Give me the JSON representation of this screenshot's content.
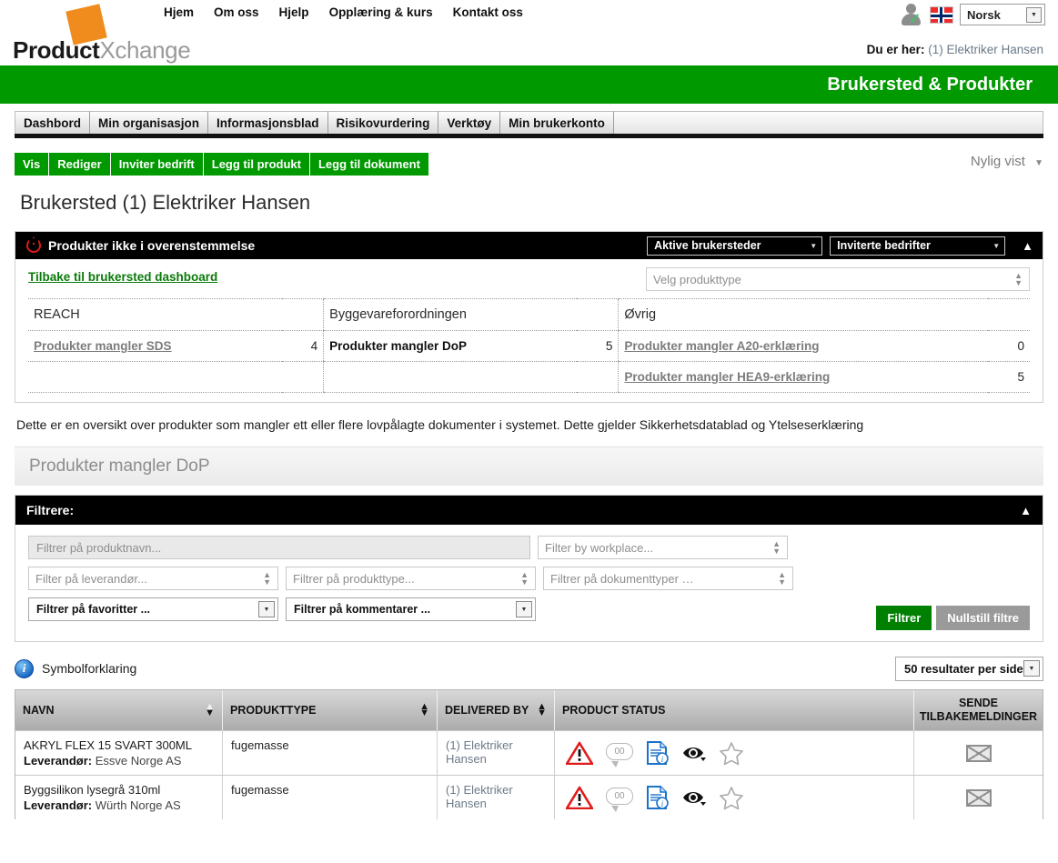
{
  "brand": {
    "bold": "Product",
    "light": "Xchange"
  },
  "topnav": [
    {
      "label": "Hjem"
    },
    {
      "label": "Om oss"
    },
    {
      "label": "Hjelp"
    },
    {
      "label": "Opplæring & kurs"
    },
    {
      "label": "Kontakt oss"
    }
  ],
  "user": {
    "language_value": "Norsk",
    "flag": "norway-flag-icon",
    "avatar": "user-verified-icon"
  },
  "breadcrumb": {
    "label": "Du er her:",
    "value": "(1) Elektriker Hansen"
  },
  "banner": {
    "title": "Brukersted & Produkter"
  },
  "tabs": [
    {
      "label": "Dashbord"
    },
    {
      "label": "Min organisasjon"
    },
    {
      "label": "Informasjonsblad"
    },
    {
      "label": "Risikovurdering"
    },
    {
      "label": "Verktøy"
    },
    {
      "label": "Min brukerkonto"
    }
  ],
  "actions": [
    {
      "label": "Vis"
    },
    {
      "label": "Rediger"
    },
    {
      "label": "Inviter bedrift"
    },
    {
      "label": "Legg til produkt"
    },
    {
      "label": "Legg til dokument"
    }
  ],
  "recent": {
    "label": "Nylig vist"
  },
  "page_title": "Brukersted (1) Elektriker Hansen",
  "noncompliance": {
    "title": "Produkter ikke i overenstemmelse",
    "select_workplaces": "Aktive brukersteder",
    "select_companies": "Inviterte bedrifter",
    "back_link": "Tilbake til brukersted dashboard",
    "product_type_placeholder": "Velg produkttype",
    "columns": [
      {
        "header": "REACH"
      },
      {
        "header": "Byggevareforordningen"
      },
      {
        "header": "Øvrig"
      }
    ],
    "rows": [
      {
        "reach_label": "Produkter mangler SDS",
        "reach_count": "4",
        "bygge_label": "Produkter mangler DoP",
        "bygge_count": "5",
        "ovrig_label": "Produkter mangler A20-erklæring",
        "ovrig_count": "0"
      },
      {
        "reach_label": "",
        "reach_count": "",
        "bygge_label": "",
        "bygge_count": "",
        "ovrig_label": "Produkter mangler HEA9-erklæring",
        "ovrig_count": "5"
      }
    ]
  },
  "description": "Dette er en oversikt over produkter som mangler ett eller flere lovpålagte dokumenter i systemet. Dette gjelder Sikkerhetsdatablad og Ytelseserklæring",
  "section_header": "Produkter mangler DoP",
  "filters": {
    "title": "Filtrere:",
    "product_name_placeholder": "Filtrer på produktnavn...",
    "workplace_placeholder": "Filter by workplace...",
    "supplier_placeholder": "Filter på leverandør...",
    "producttype_placeholder": "Filtrer på produkttype...",
    "documenttype_placeholder": "Filtrer på dokumenttyper …",
    "favourites_placeholder": "Filtrer på favoritter ...",
    "comments_placeholder": "Filtrer på kommentarer ...",
    "apply_label": "Filtrer",
    "reset_label": "Nullstill filtre"
  },
  "legend": {
    "label": "Symbolforklaring",
    "icon": "info-icon"
  },
  "per_page": {
    "value": "50 resultater per side"
  },
  "table": {
    "columns": [
      {
        "header": "NAVN",
        "sortable": true
      },
      {
        "header": "PRODUKTTYPE",
        "sortable": true
      },
      {
        "header": "DELIVERED BY",
        "sortable": true
      },
      {
        "header": "PRODUCT STATUS",
        "sortable": false
      },
      {
        "header": "SENDE TILBAKEMELDINGER",
        "sortable": false
      }
    ],
    "supplier_label": "Leverandør:",
    "rows": [
      {
        "name": "AKRYL FLEX 15 SVART 300ML",
        "supplier": "Essve Norge AS",
        "producttype": "fugemasse",
        "delivered_by": "(1) Elektriker Hansen",
        "comment_count": "00",
        "status_icons": [
          "warning-triangle-icon",
          "comment-bubble-icon",
          "document-info-icon",
          "eye-icon",
          "star-icon"
        ],
        "feedback_icon": "envelope-icon"
      },
      {
        "name": "Byggsilikon lysegrå 310ml",
        "supplier": "Würth Norge AS",
        "producttype": "fugemasse",
        "delivered_by": "(1) Elektriker Hansen",
        "comment_count": "00",
        "status_icons": [
          "warning-triangle-icon",
          "comment-bubble-icon",
          "document-info-icon",
          "eye-icon",
          "star-icon"
        ],
        "feedback_icon": "envelope-icon"
      }
    ]
  },
  "colors": {
    "brand_green": "#009900",
    "logo_orange": "#F08C1E",
    "alert_red": "#e01b1b",
    "link_gray": "#7c7c7c"
  }
}
